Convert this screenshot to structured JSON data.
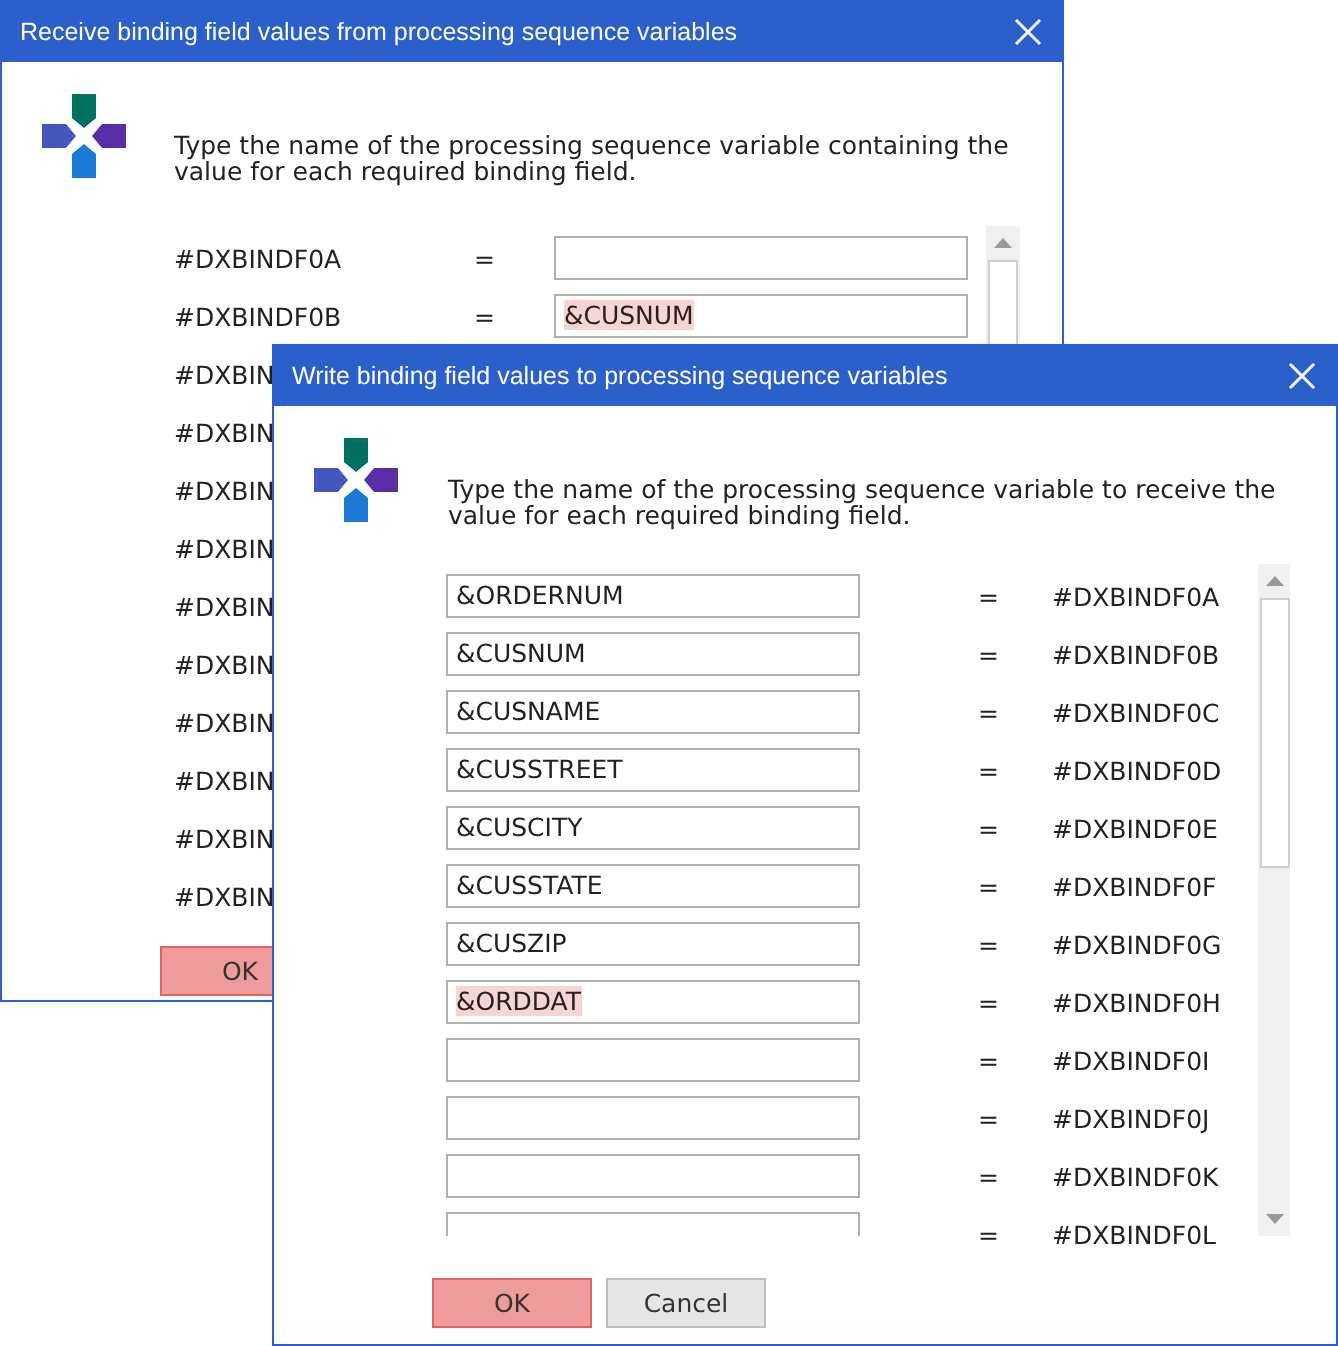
{
  "windows": [
    {
      "title": "Receive binding field values from processing sequence variables",
      "instruction": "Type the name of the processing sequence variable containing the value for each required binding field.",
      "rows": [
        {
          "kind": "label_first",
          "binding": "#DXBINDF0A",
          "equals": "="
        },
        {
          "kind": "label_first",
          "binding": "#DXBINDF0B",
          "equals": "=",
          "variable": "&CUSNUM",
          "highlighted": true
        },
        {
          "kind": "label",
          "binding": "#DXBIN"
        },
        {
          "kind": "label",
          "binding": "#DXBIN"
        },
        {
          "kind": "label",
          "binding": "#DXBIN"
        },
        {
          "kind": "label",
          "binding": "#DXBIN"
        },
        {
          "kind": "label",
          "binding": "#DXBIN"
        },
        {
          "kind": "label",
          "binding": "#DXBIN"
        },
        {
          "kind": "label",
          "binding": "#DXBIN"
        },
        {
          "kind": "label",
          "binding": "#DXBIN"
        },
        {
          "kind": "label",
          "binding": "#DXBIN"
        },
        {
          "kind": "label",
          "binding": "#DXBIN"
        }
      ],
      "buttons": [
        {
          "label": "OK",
          "kind": "default"
        }
      ]
    },
    {
      "title": "Write binding field values to processing sequence variables",
      "instruction": "Type the name of the processing sequence variable to receive the value for each required binding field.",
      "rows": [
        {
          "kind": "field_first",
          "binding": "#DXBINDF0A",
          "equals": "=",
          "variable": "&ORDERNUM",
          "highlighted": false
        },
        {
          "kind": "field_first",
          "binding": "#DXBINDF0B",
          "equals": "=",
          "variable": "&CUSNUM",
          "highlighted": false
        },
        {
          "kind": "field_first",
          "binding": "#DXBINDF0C",
          "equals": "=",
          "variable": "&CUSNAME",
          "highlighted": false
        },
        {
          "kind": "field_first",
          "binding": "#DXBINDF0D",
          "equals": "=",
          "variable": "&CUSSTREET",
          "highlighted": false
        },
        {
          "kind": "field_first",
          "binding": "#DXBINDF0E",
          "equals": "=",
          "variable": "&CUSCITY",
          "highlighted": false
        },
        {
          "kind": "field_first",
          "binding": "#DXBINDF0F",
          "equals": "=",
          "variable": "&CUSSTATE",
          "highlighted": false
        },
        {
          "kind": "field_first",
          "binding": "#DXBINDF0G",
          "equals": "=",
          "variable": "&CUSZIP",
          "highlighted": false
        },
        {
          "kind": "field_first",
          "binding": "#DXBINDF0H",
          "equals": "=",
          "variable": "&ORDDAT",
          "highlighted": true
        },
        {
          "kind": "field_first",
          "binding": "#DXBINDF0I",
          "equals": "="
        },
        {
          "kind": "field_first",
          "binding": "#DXBINDF0J",
          "equals": "="
        },
        {
          "kind": "field_first",
          "binding": "#DXBINDF0K",
          "equals": "="
        },
        {
          "kind": "field_first_cut",
          "binding": "#DXBINDF0L",
          "equals": "="
        }
      ],
      "buttons": [
        {
          "label": "OK",
          "kind": "default"
        },
        {
          "label": "Cancel",
          "kind": "normal"
        }
      ]
    }
  ]
}
